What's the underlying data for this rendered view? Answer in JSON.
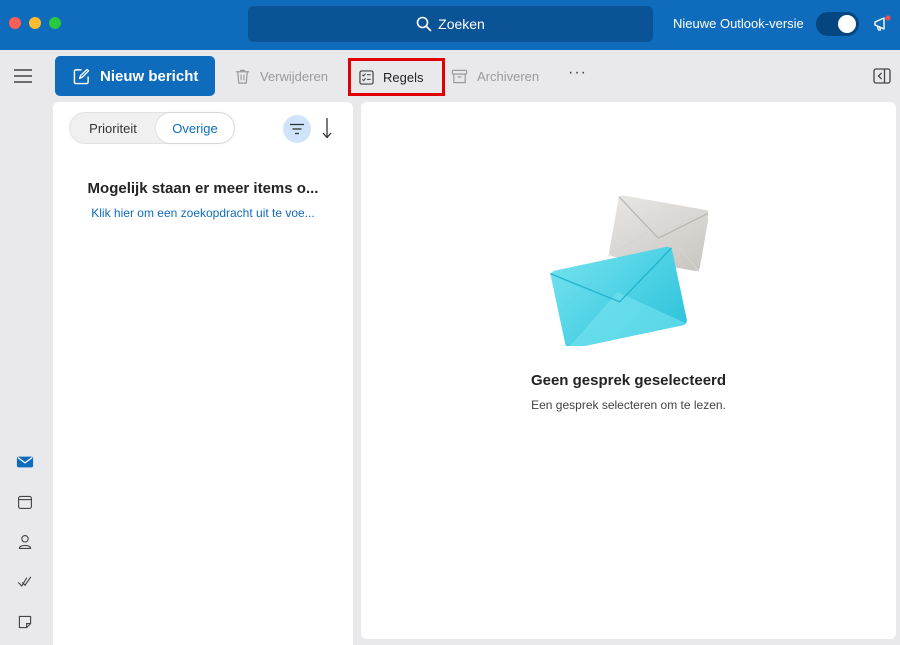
{
  "titlebar": {
    "search_label": "Zoeken",
    "toggle_label": "Nieuwe Outlook-versie",
    "toggle_on": true,
    "accent_color": "#0f6cbd"
  },
  "toolbar": {
    "new_message": "Nieuw bericht",
    "delete": "Verwijderen",
    "rules": "Regels",
    "archive": "Archiveren",
    "more": "···"
  },
  "message_list": {
    "tabs": [
      "Prioriteit",
      "Overige"
    ],
    "active_tab": "Overige",
    "info_title": "Mogelijk staan er meer items o...",
    "info_link": "Klik hier om een zoekopdracht uit te voe..."
  },
  "reading_pane": {
    "empty_title": "Geen gesprek geselecteerd",
    "empty_subtitle": "Een gesprek selecteren om te lezen."
  },
  "rail": {
    "icons": [
      "mail-icon",
      "calendar-icon",
      "people-icon",
      "todo-icon",
      "notes-icon"
    ]
  }
}
